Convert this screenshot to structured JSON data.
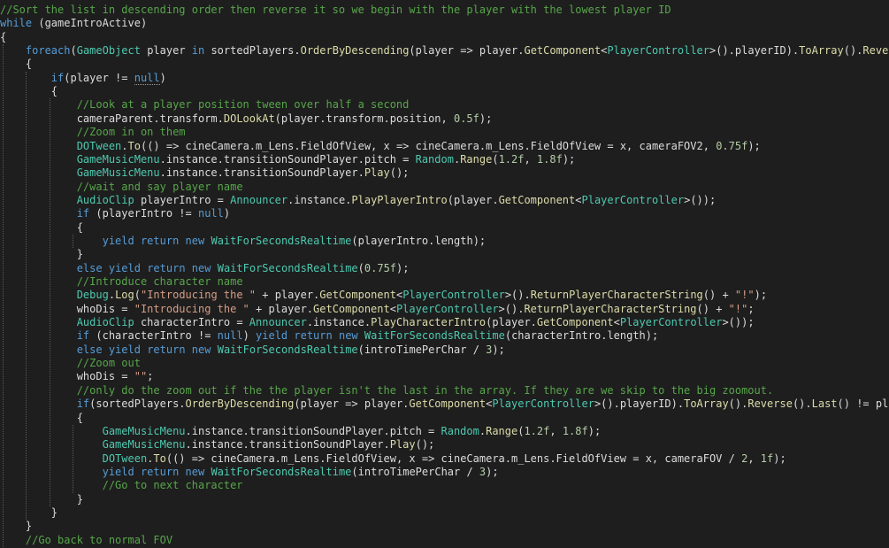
{
  "colors": {
    "background": "#1e1e1e",
    "comment": "#57a64a",
    "keyword": "#569cd6",
    "type": "#4ec9b0",
    "method": "#dcdcaa",
    "string": "#d69d85",
    "number": "#b5cea8",
    "plain": "#dcdcdc",
    "guide": "#5a5a5a"
  },
  "code_lines": [
    [
      [
        "c",
        "//Sort the list in descending order then reverse it so we begin with the player with the lowest player ID"
      ]
    ],
    [
      [
        "k",
        "while"
      ],
      [
        "p",
        " (gameIntroActive)"
      ]
    ],
    [
      [
        "p",
        "{"
      ]
    ],
    [
      [
        "p",
        "    "
      ],
      [
        "k",
        "foreach"
      ],
      [
        "p",
        "("
      ],
      [
        "t",
        "GameObject"
      ],
      [
        "p",
        " player "
      ],
      [
        "k",
        "in"
      ],
      [
        "p",
        " sortedPlayers."
      ],
      [
        "m",
        "OrderByDescending"
      ],
      [
        "p",
        "(player => player."
      ],
      [
        "m",
        "GetComponent"
      ],
      [
        "p",
        "<"
      ],
      [
        "t",
        "PlayerController"
      ],
      [
        "p",
        ">().playerID)."
      ],
      [
        "m",
        "ToArray"
      ],
      [
        "p",
        "()."
      ],
      [
        "m",
        "Reverse"
      ],
      [
        "p",
        "())"
      ]
    ],
    [
      [
        "p",
        "    {"
      ]
    ],
    [
      [
        "p",
        "        "
      ],
      [
        "k",
        "if"
      ],
      [
        "p",
        "(player != "
      ],
      [
        "ks",
        "null"
      ],
      [
        "p",
        ")"
      ]
    ],
    [
      [
        "p",
        "        {"
      ]
    ],
    [
      [
        "p",
        "            "
      ],
      [
        "c",
        "//Look at a player position tween over half a second"
      ]
    ],
    [
      [
        "p",
        "            cameraParent.transform."
      ],
      [
        "m",
        "DOLookAt"
      ],
      [
        "p",
        "(player.transform.position, "
      ],
      [
        "n",
        "0.5f"
      ],
      [
        "p",
        ");"
      ]
    ],
    [
      [
        "p",
        "            "
      ],
      [
        "c",
        "//Zoom in on them"
      ]
    ],
    [
      [
        "p",
        "            "
      ],
      [
        "t",
        "DOTween"
      ],
      [
        "p",
        "."
      ],
      [
        "m",
        "To"
      ],
      [
        "p",
        "(() => cineCamera.m_Lens.FieldOfView, x => cineCamera.m_Lens.FieldOfView = x, cameraFOV2, "
      ],
      [
        "n",
        "0.75f"
      ],
      [
        "p",
        ");"
      ]
    ],
    [
      [
        "p",
        "            "
      ],
      [
        "t",
        "GameMusicMenu"
      ],
      [
        "p",
        ".instance.transitionSoundPlayer.pitch = "
      ],
      [
        "t",
        "Random"
      ],
      [
        "p",
        "."
      ],
      [
        "m",
        "Range"
      ],
      [
        "p",
        "("
      ],
      [
        "n",
        "1.2f"
      ],
      [
        "p",
        ", "
      ],
      [
        "n",
        "1.8f"
      ],
      [
        "p",
        ");"
      ]
    ],
    [
      [
        "p",
        "            "
      ],
      [
        "t",
        "GameMusicMenu"
      ],
      [
        "p",
        ".instance.transitionSoundPlayer."
      ],
      [
        "m",
        "Play"
      ],
      [
        "p",
        "();"
      ]
    ],
    [
      [
        "p",
        "            "
      ],
      [
        "c",
        "//wait and say player name"
      ]
    ],
    [
      [
        "p",
        "            "
      ],
      [
        "t",
        "AudioClip"
      ],
      [
        "p",
        " playerIntro = "
      ],
      [
        "t",
        "Announcer"
      ],
      [
        "p",
        ".instance."
      ],
      [
        "m",
        "PlayPlayerIntro"
      ],
      [
        "p",
        "(player."
      ],
      [
        "m",
        "GetComponent"
      ],
      [
        "p",
        "<"
      ],
      [
        "t",
        "PlayerController"
      ],
      [
        "p",
        ">());"
      ]
    ],
    [
      [
        "p",
        "            "
      ],
      [
        "k",
        "if"
      ],
      [
        "p",
        " (playerIntro != "
      ],
      [
        "k",
        "null"
      ],
      [
        "p",
        ")"
      ]
    ],
    [
      [
        "p",
        "            {"
      ]
    ],
    [
      [
        "p",
        "                "
      ],
      [
        "k",
        "yield"
      ],
      [
        "p",
        " "
      ],
      [
        "k",
        "return"
      ],
      [
        "p",
        " "
      ],
      [
        "k",
        "new"
      ],
      [
        "p",
        " "
      ],
      [
        "t",
        "WaitForSecondsRealtime"
      ],
      [
        "p",
        "(playerIntro.length);"
      ]
    ],
    [
      [
        "p",
        "            }"
      ]
    ],
    [
      [
        "p",
        "            "
      ],
      [
        "k",
        "else"
      ],
      [
        "p",
        " "
      ],
      [
        "k",
        "yield"
      ],
      [
        "p",
        " "
      ],
      [
        "k",
        "return"
      ],
      [
        "p",
        " "
      ],
      [
        "k",
        "new"
      ],
      [
        "p",
        " "
      ],
      [
        "t",
        "WaitForSecondsRealtime"
      ],
      [
        "p",
        "("
      ],
      [
        "n",
        "0.75f"
      ],
      [
        "p",
        ");"
      ]
    ],
    [
      [
        "p",
        "            "
      ],
      [
        "c",
        "//Introduce character name"
      ]
    ],
    [
      [
        "p",
        "            "
      ],
      [
        "t",
        "Debug"
      ],
      [
        "p",
        "."
      ],
      [
        "m",
        "Log"
      ],
      [
        "p",
        "("
      ],
      [
        "s",
        "\"Introducing the \""
      ],
      [
        "p",
        " + player."
      ],
      [
        "m",
        "GetComponent"
      ],
      [
        "p",
        "<"
      ],
      [
        "t",
        "PlayerController"
      ],
      [
        "p",
        ">()."
      ],
      [
        "m",
        "ReturnPlayerCharacterString"
      ],
      [
        "p",
        "() + "
      ],
      [
        "s",
        "\"!\""
      ],
      [
        "p",
        ");"
      ]
    ],
    [
      [
        "p",
        "            whoDis = "
      ],
      [
        "s",
        "\"Introducing the \""
      ],
      [
        "p",
        " + player."
      ],
      [
        "m",
        "GetComponent"
      ],
      [
        "p",
        "<"
      ],
      [
        "t",
        "PlayerController"
      ],
      [
        "p",
        ">()."
      ],
      [
        "m",
        "ReturnPlayerCharacterString"
      ],
      [
        "p",
        "() + "
      ],
      [
        "s",
        "\"!\""
      ],
      [
        "p",
        ";"
      ]
    ],
    [
      [
        "p",
        "            "
      ],
      [
        "t",
        "AudioClip"
      ],
      [
        "p",
        " characterIntro = "
      ],
      [
        "t",
        "Announcer"
      ],
      [
        "p",
        ".instance."
      ],
      [
        "m",
        "PlayCharacterIntro"
      ],
      [
        "p",
        "(player."
      ],
      [
        "m",
        "GetComponent"
      ],
      [
        "p",
        "<"
      ],
      [
        "t",
        "PlayerController"
      ],
      [
        "p",
        ">());"
      ]
    ],
    [
      [
        "p",
        "            "
      ],
      [
        "k",
        "if"
      ],
      [
        "p",
        " (characterIntro != "
      ],
      [
        "k",
        "null"
      ],
      [
        "p",
        ") "
      ],
      [
        "k",
        "yield"
      ],
      [
        "p",
        " "
      ],
      [
        "k",
        "return"
      ],
      [
        "p",
        " "
      ],
      [
        "k",
        "new"
      ],
      [
        "p",
        " "
      ],
      [
        "t",
        "WaitForSecondsRealtime"
      ],
      [
        "p",
        "(characterIntro.length);"
      ]
    ],
    [
      [
        "p",
        "            "
      ],
      [
        "k",
        "else"
      ],
      [
        "p",
        " "
      ],
      [
        "k",
        "yield"
      ],
      [
        "p",
        " "
      ],
      [
        "k",
        "return"
      ],
      [
        "p",
        " "
      ],
      [
        "k",
        "new"
      ],
      [
        "p",
        " "
      ],
      [
        "t",
        "WaitForSecondsRealtime"
      ],
      [
        "p",
        "(introTimePerChar / "
      ],
      [
        "n",
        "3"
      ],
      [
        "p",
        ");"
      ]
    ],
    [
      [
        "p",
        "            "
      ],
      [
        "c",
        "//Zoom out"
      ]
    ],
    [
      [
        "p",
        "            whoDis = "
      ],
      [
        "s",
        "\"\""
      ],
      [
        "p",
        ";"
      ]
    ],
    [
      [
        "p",
        "            "
      ],
      [
        "c",
        "//only do the zoom out if the the player isn't the last in the array. If they are we skip to the big zoomout."
      ]
    ],
    [
      [
        "p",
        "            "
      ],
      [
        "k",
        "if"
      ],
      [
        "p",
        "(sortedPlayers."
      ],
      [
        "m",
        "OrderByDescending"
      ],
      [
        "p",
        "(player => player."
      ],
      [
        "m",
        "GetComponent"
      ],
      [
        "p",
        "<"
      ],
      [
        "t",
        "PlayerController"
      ],
      [
        "p",
        ">().playerID)."
      ],
      [
        "m",
        "ToArray"
      ],
      [
        "p",
        "()."
      ],
      [
        "m",
        "Reverse"
      ],
      [
        "p",
        "()."
      ],
      [
        "m",
        "Last"
      ],
      [
        "p",
        "() != player)"
      ]
    ],
    [
      [
        "p",
        "            {"
      ]
    ],
    [
      [
        "p",
        "                "
      ],
      [
        "t",
        "GameMusicMenu"
      ],
      [
        "p",
        ".instance.transitionSoundPlayer.pitch = "
      ],
      [
        "t",
        "Random"
      ],
      [
        "p",
        "."
      ],
      [
        "m",
        "Range"
      ],
      [
        "p",
        "("
      ],
      [
        "n",
        "1.2f"
      ],
      [
        "p",
        ", "
      ],
      [
        "n",
        "1.8f"
      ],
      [
        "p",
        ");"
      ]
    ],
    [
      [
        "p",
        "                "
      ],
      [
        "t",
        "GameMusicMenu"
      ],
      [
        "p",
        ".instance.transitionSoundPlayer."
      ],
      [
        "m",
        "Play"
      ],
      [
        "p",
        "();"
      ]
    ],
    [
      [
        "p",
        "                "
      ],
      [
        "t",
        "DOTween"
      ],
      [
        "p",
        "."
      ],
      [
        "m",
        "To"
      ],
      [
        "p",
        "(() => cineCamera.m_Lens.FieldOfView, x => cineCamera.m_Lens.FieldOfView = x, cameraFOV / "
      ],
      [
        "n",
        "2"
      ],
      [
        "p",
        ", "
      ],
      [
        "n",
        "1f"
      ],
      [
        "p",
        ");"
      ]
    ],
    [
      [
        "p",
        "                "
      ],
      [
        "k",
        "yield"
      ],
      [
        "p",
        " "
      ],
      [
        "k",
        "return"
      ],
      [
        "p",
        " "
      ],
      [
        "k",
        "new"
      ],
      [
        "p",
        " "
      ],
      [
        "t",
        "WaitForSecondsRealtime"
      ],
      [
        "p",
        "(introTimePerChar / "
      ],
      [
        "n",
        "3"
      ],
      [
        "p",
        ");"
      ]
    ],
    [
      [
        "p",
        "                "
      ],
      [
        "c",
        "//Go to next character"
      ]
    ],
    [
      [
        "p",
        "            }"
      ]
    ],
    [
      [
        "p",
        "        }"
      ]
    ],
    [
      [
        "p",
        "    }"
      ]
    ],
    [
      [
        "p",
        "    "
      ],
      [
        "c",
        "//Go back to normal FOV"
      ]
    ]
  ]
}
